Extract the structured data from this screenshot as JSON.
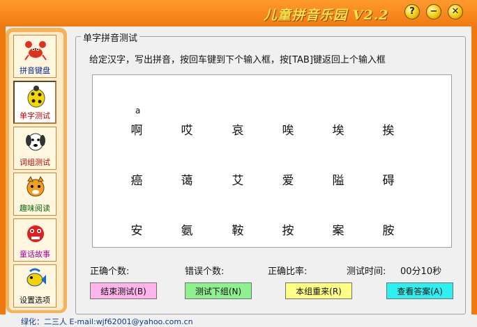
{
  "window": {
    "title": "儿童拼音乐园 V2.2",
    "help": "?",
    "minimize": "−",
    "close": "✕"
  },
  "sidebar": {
    "items": [
      {
        "label": "拼音键盘",
        "color": "#0a2a8a"
      },
      {
        "label": "单字测试",
        "color": "#c00000"
      },
      {
        "label": "词组测试",
        "color": "#c00000"
      },
      {
        "label": "趣味阅读",
        "color": "#0a6a0a"
      },
      {
        "label": "童话故事",
        "color": "#a000a0"
      },
      {
        "label": "设置选项",
        "color": "#111111"
      }
    ]
  },
  "main": {
    "group_title": "单字拼音测试",
    "instruction": "给定汉字，写出拼音，按回车键到下个输入框，按[TAB]键返回上个输入框",
    "first_pinyin": "a",
    "hanzi_rows": [
      [
        "啊",
        "哎",
        "哀",
        "唉",
        "埃",
        "挨"
      ],
      [
        "癌",
        "蔼",
        "艾",
        "爱",
        "隘",
        "碍"
      ],
      [
        "安",
        "氨",
        "鞍",
        "按",
        "案",
        "胺"
      ]
    ],
    "stats": {
      "correct_label": "正确个数:",
      "wrong_label": "错误个数:",
      "ratio_label": "正确比率:",
      "time_label": "测试时间:",
      "time_value": "00分10秒"
    },
    "buttons": {
      "finish": "结束测试(B)",
      "next": "测试下组(N)",
      "redo": "本组重来(R)",
      "answer": "查看答案(A)"
    }
  },
  "footer": {
    "text": "绿化：二三人 E-mail:wjf62001@yahoo.com.cn"
  }
}
